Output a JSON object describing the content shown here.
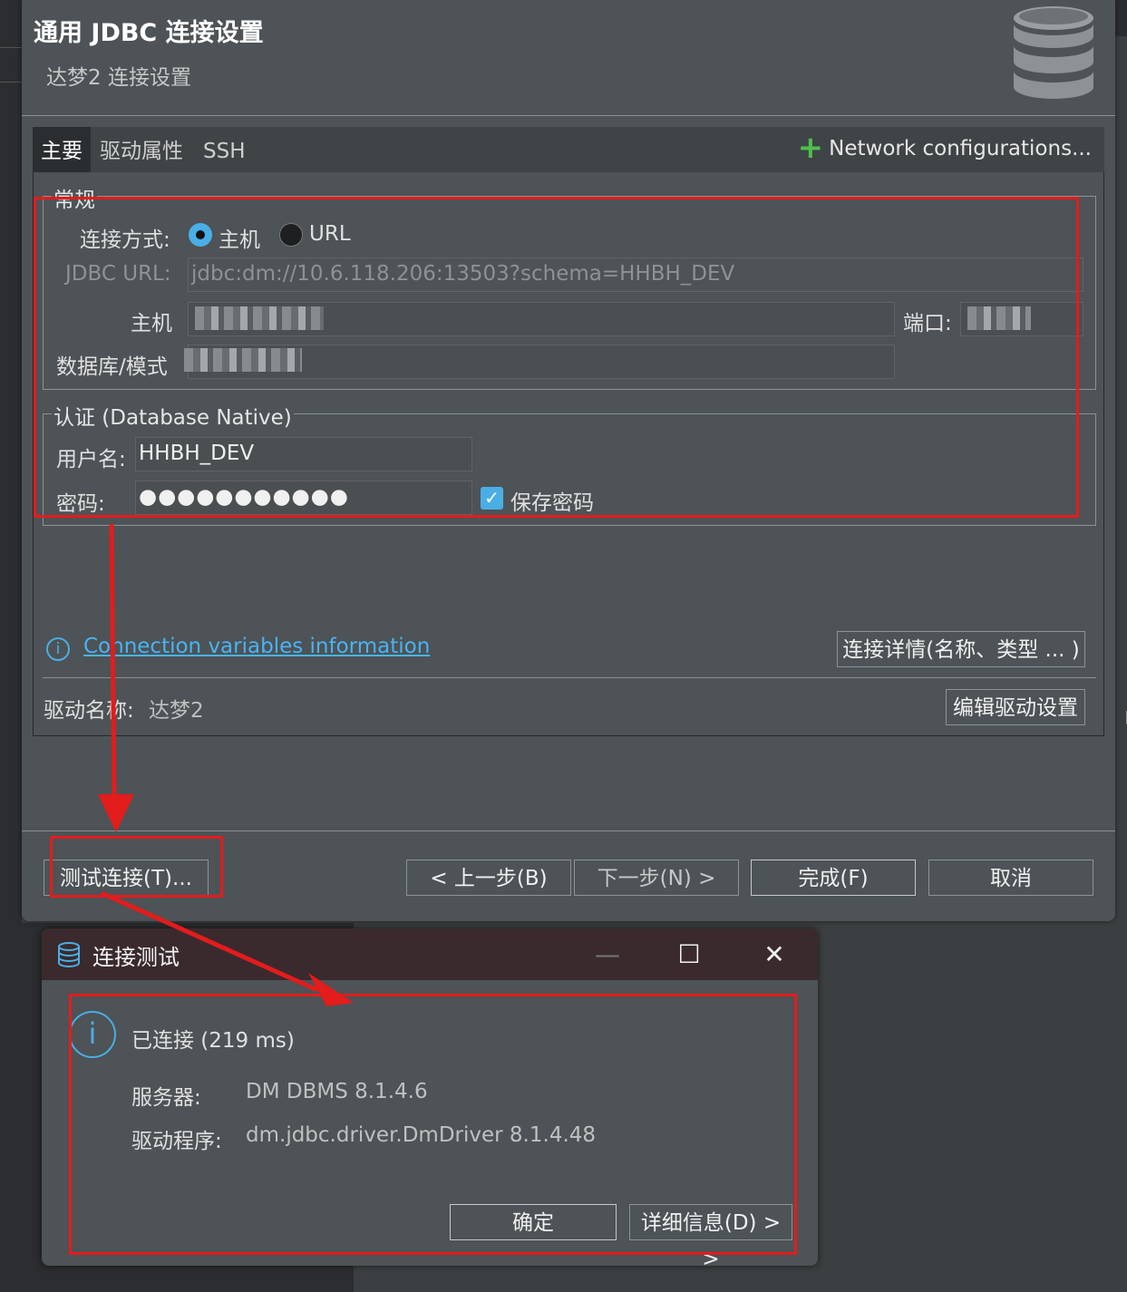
{
  "main_dialog": {
    "title": "通用 JDBC 连接设置",
    "subtitle": "达梦2 连接设置",
    "tabs": [
      "主要",
      "驱动属性",
      "SSH"
    ],
    "network_configurations": "Network configurations...",
    "general_group": {
      "title": "常规",
      "connect_mode_label": "连接方式:",
      "radio_host": "主机",
      "radio_url": "URL",
      "jdbc_url_label": "JDBC URL:",
      "jdbc_url_value": "jdbc:dm://10.6.118.206:13503?schema=HHBH_DEV",
      "host_label": "主机",
      "port_label": "端口:",
      "database_label": "数据库/模式"
    },
    "auth_group": {
      "title": "认证 (Database Native)",
      "username_label": "用户名:",
      "username_value": "HHBH_DEV",
      "password_label": "密码:",
      "password_value": "●●●●●●●●●●●",
      "save_password_label": "保存密码",
      "save_password_checked": true
    },
    "conn_vars_link": "Connection variables information",
    "conn_details_button": "连接详情(名称、类型 ... )",
    "driver_name_label": "驱动名称:",
    "driver_name_value": "达梦2",
    "edit_driver_button": "编辑驱动设置",
    "footer_buttons": {
      "test": "测试连接(T)...",
      "back": "< 上一步(B)",
      "next": "下一步(N) >",
      "finish": "完成(F)",
      "cancel": "取消"
    }
  },
  "test_dialog": {
    "title": "连接测试",
    "status": "已连接 (219 ms)",
    "server_label": "服务器:",
    "server_value": "DM DBMS 8.1.4.6",
    "driver_label": "驱动程序:",
    "driver_value": "dm.jdbc.driver.DmDriver 8.1.4.48",
    "ok_button": "确定",
    "details_button": "详细信息(D) > >",
    "minimize_icon": "—",
    "maximize_icon": "☐",
    "close_icon": "✕"
  },
  "colors": {
    "annotation_red": "#e31c1c",
    "accent_blue": "#4aaee6",
    "plus_green": "#4ec04e"
  }
}
